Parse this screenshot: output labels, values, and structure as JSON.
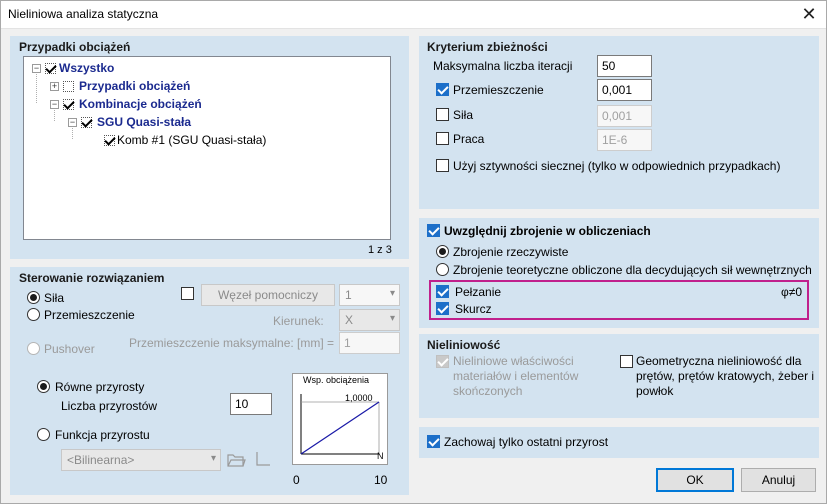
{
  "window": {
    "title": "Nieliniowa analiza statyczna",
    "close_glyph": "✕"
  },
  "load_cases": {
    "title": "Przypadki obciążeń",
    "tree": {
      "root": "Wszystko",
      "group1": "Przypadki obciążeń",
      "group2": "Kombinacje obciążeń",
      "sub": "SGU Quasi-stała",
      "leaf": "Komb #1 (SGU Quasi-stała)"
    },
    "count": "1 z 3"
  },
  "solution_control": {
    "title": "Sterowanie rozwiązaniem",
    "radio_force": "Siła",
    "radio_displacement": "Przemieszczenie",
    "radio_pushover": "Pushover",
    "aux_node_label": "Węzeł pomocniczy",
    "aux_node_value": "1",
    "direction_label": "Kierunek:",
    "direction_value": "X",
    "max_disp_label": "Przemieszczenie maksymalne: [mm] =",
    "max_disp_value": "1",
    "equal_increments": "Równe przyrosty",
    "increments_count_label": "Liczba przyrostów",
    "increments_count_value": "10",
    "increment_function": "Funkcja przyrostu",
    "function_value": "<Bilinearna>",
    "graph": {
      "title": "Wsp. obciążenia",
      "ymax": "1,0000",
      "x_unit": "N",
      "x_min": "0",
      "x_max": "10"
    }
  },
  "convergence": {
    "title": "Kryterium zbieżności",
    "max_iter_label": "Maksymalna liczba iteracji",
    "max_iter_value": "50",
    "displacement_label": "Przemieszczenie",
    "displacement_value": "0,001",
    "force_label": "Siła",
    "force_value": "0,001",
    "work_label": "Praca",
    "work_value": "1E-6",
    "secant_label": "Użyj sztywności siecznej (tylko w odpowiednich przypadkach)"
  },
  "reinforcement": {
    "title": "Uwzględnij zbrojenie w obliczeniach",
    "actual": "Zbrojenie rzeczywiste",
    "theoretical": "Zbrojenie teoretyczne obliczone dla decydujących sił wewnętrznych",
    "creep": "Pełzanie",
    "phi_label": "φ≠0",
    "shrinkage": "Skurcz"
  },
  "nonlinearity": {
    "title": "Nieliniowość",
    "material": "Nieliniowe właściwości materiałów i elementów skończonych",
    "geometric": "Geometryczna nieliniowość dla prętów, prętów kratowych, żeber i powłok"
  },
  "keep_last": "Zachowaj tylko ostatni przyrost",
  "buttons": {
    "ok": "OK",
    "cancel": "Anuluj"
  }
}
